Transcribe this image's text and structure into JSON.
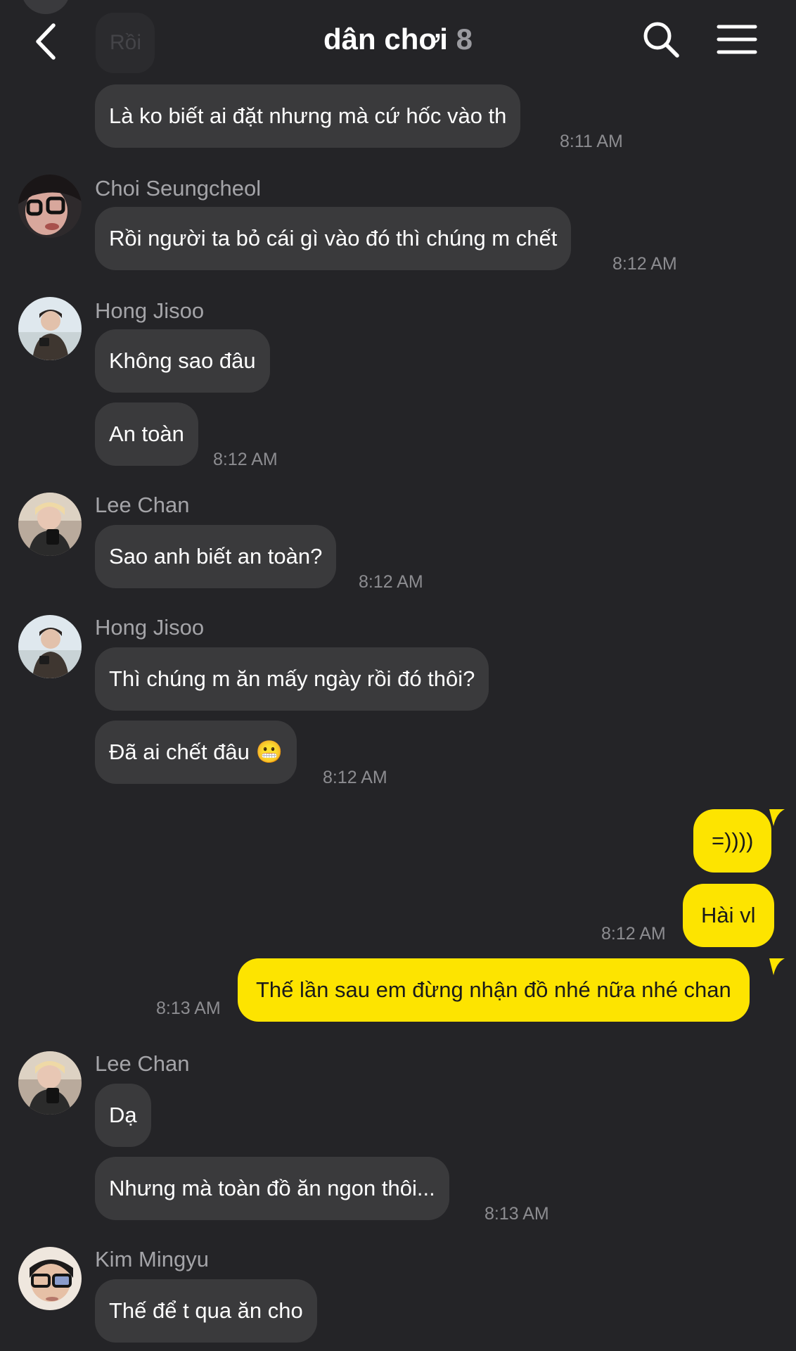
{
  "header": {
    "title": "dân chơi",
    "member_count": "8",
    "faded_text": "Rồi"
  },
  "colors": {
    "background": "#242427",
    "incoming_bubble": "#3a3a3c",
    "outgoing_bubble": "#fde400",
    "timestamp": "#8c8c90",
    "sender_name": "#a4a4a8"
  },
  "icons": {
    "back": "chevron-left-icon",
    "search": "search-icon",
    "menu": "menu-icon"
  },
  "messages": [
    {
      "sender": "",
      "text": "Là ko biết ai đặt nhưng mà cứ hốc vào th",
      "time": "8:11 AM"
    },
    {
      "sender": "Choi Seungcheol",
      "text": "Rồi người ta bỏ cái gì vào đó thì chúng m chết",
      "time": "8:12 AM"
    },
    {
      "sender": "Hong Jisoo",
      "text": "Không sao đâu",
      "time": ""
    },
    {
      "sender": "",
      "text": "An toàn",
      "time": "8:12 AM"
    },
    {
      "sender": "Lee Chan",
      "text": "Sao anh biết an toàn?",
      "time": "8:12 AM"
    },
    {
      "sender": "Hong Jisoo",
      "text": "Thì chúng m ăn mấy ngày rồi đó thôi?",
      "time": ""
    },
    {
      "sender": "",
      "text": "Đã ai chết đâu 😬",
      "time": "8:12 AM"
    },
    {
      "sender": "me",
      "text": "=))))",
      "time": ""
    },
    {
      "sender": "me",
      "text": "Hài vl",
      "time": "8:12 AM"
    },
    {
      "sender": "me",
      "text": "Thế lần sau em đừng nhận đồ nhé nữa nhé chan",
      "time": "8:13 AM"
    },
    {
      "sender": "Lee Chan",
      "text": "Dạ",
      "time": ""
    },
    {
      "sender": "",
      "text": "Nhưng mà toàn đồ ăn ngon thôi...",
      "time": "8:13 AM"
    },
    {
      "sender": "Kim Mingyu",
      "text": "Thế để t qua ăn cho",
      "time": ""
    }
  ]
}
